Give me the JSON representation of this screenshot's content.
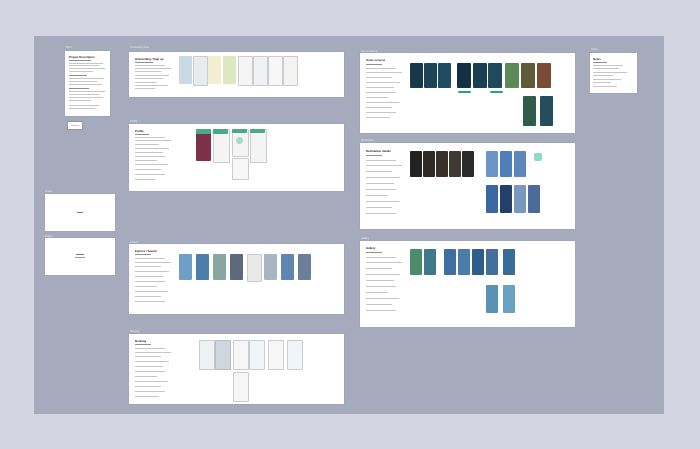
{
  "canvas": {
    "background": "#a5aabd",
    "frame": "#d3d6e2"
  },
  "boards": [
    {
      "id": "brief-doc",
      "label": "Brief",
      "title": "Project Description"
    },
    {
      "id": "onboarding",
      "label": "Onboarding flow",
      "title": "Onboarding / Sign up"
    },
    {
      "id": "profile",
      "label": "Profile",
      "title": "Profile"
    },
    {
      "id": "search",
      "label": "Search",
      "title": "Explore / Search"
    },
    {
      "id": "booking",
      "label": "Booking",
      "title": "Booking"
    },
    {
      "id": "dark-app",
      "label": "Home screens",
      "title": "Home screens"
    },
    {
      "id": "destination",
      "label": "Destination",
      "title": "Destination details"
    },
    {
      "id": "gallery",
      "label": "Gallery",
      "title": "Gallery"
    },
    {
      "id": "notes",
      "label": "Notes",
      "title": "Notes"
    },
    {
      "id": "placeholder-a",
      "label": "Frame",
      "title": "Empty"
    },
    {
      "id": "placeholder-b",
      "label": "Frame",
      "title": "Placeholder"
    }
  ]
}
